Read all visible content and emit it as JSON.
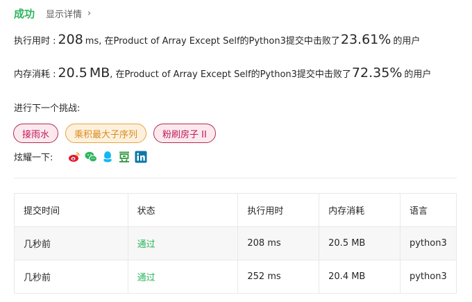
{
  "result": {
    "status": "成功",
    "details_link": "显示详情",
    "chevron": "›"
  },
  "runtime": {
    "label": "执行用时 :",
    "value": "208",
    "unit": "ms",
    "mid": ", 在Product of Array Except Self的Python3提交中击败了",
    "percent": "23.61%",
    "suffix": "的用户"
  },
  "memory": {
    "label": "内存消耗 :",
    "value": "20.5",
    "unit": "MB",
    "mid": ", 在Product of Array Except Self的Python3提交中击败了",
    "percent": "72.35%",
    "suffix": "的用户"
  },
  "next_challenge": {
    "label": "进行下一个挑战:",
    "tags": [
      {
        "label": "接雨水",
        "difficulty": "hard"
      },
      {
        "label": "乘积最大子序列",
        "difficulty": "medium"
      },
      {
        "label": "粉刷房子 II",
        "difficulty": "hard"
      }
    ]
  },
  "share": {
    "label": "炫耀一下:",
    "icons": [
      "weibo-icon",
      "wechat-icon",
      "qq-icon",
      "douban-icon",
      "linkedin-icon"
    ],
    "colors": {
      "weibo": "#e6162d",
      "wechat": "#2db55d",
      "qq": "#12b7f5",
      "douban": "#2e963d",
      "linkedin": "#0e76a8"
    }
  },
  "table": {
    "headers": [
      "提交时间",
      "状态",
      "执行用时",
      "内存消耗",
      "语言"
    ],
    "rows": [
      [
        "几秒前",
        "通过",
        "208 ms",
        "20.5 MB",
        "python3"
      ],
      [
        "几秒前",
        "通过",
        "252 ms",
        "20.4 MB",
        "python3"
      ]
    ]
  },
  "colors": {
    "success": "#2db55d",
    "hard_tag": "#c2185b",
    "medium_tag": "#d98a1c"
  }
}
